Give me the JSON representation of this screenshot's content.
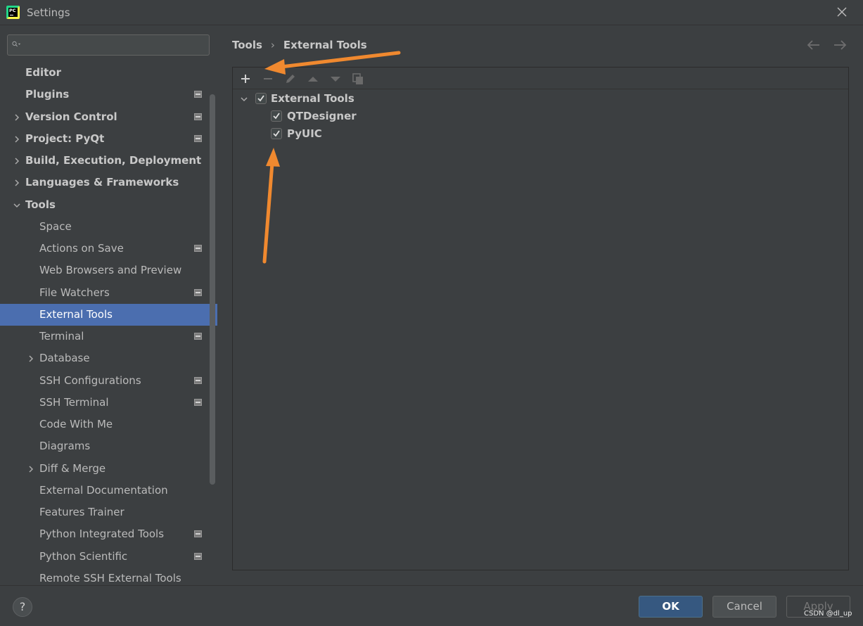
{
  "window": {
    "title": "Settings",
    "close_icon": "close-icon",
    "app_icon_text": "PC"
  },
  "search": {
    "value": "",
    "placeholder": ""
  },
  "sidebar": {
    "items": [
      {
        "label": "Editor",
        "level": 0,
        "expandable": false,
        "expanded": false,
        "config_icon": false,
        "selected": false
      },
      {
        "label": "Plugins",
        "level": 0,
        "expandable": false,
        "expanded": false,
        "config_icon": true,
        "selected": false
      },
      {
        "label": "Version Control",
        "level": 0,
        "expandable": true,
        "expanded": false,
        "config_icon": true,
        "selected": false
      },
      {
        "label": "Project: PyQt",
        "level": 0,
        "expandable": true,
        "expanded": false,
        "config_icon": true,
        "selected": false
      },
      {
        "label": "Build, Execution, Deployment",
        "level": 0,
        "expandable": true,
        "expanded": false,
        "config_icon": false,
        "selected": false
      },
      {
        "label": "Languages & Frameworks",
        "level": 0,
        "expandable": true,
        "expanded": false,
        "config_icon": false,
        "selected": false
      },
      {
        "label": "Tools",
        "level": 0,
        "expandable": true,
        "expanded": true,
        "config_icon": false,
        "selected": false
      },
      {
        "label": "Space",
        "level": 1,
        "expandable": false,
        "expanded": false,
        "config_icon": false,
        "selected": false
      },
      {
        "label": "Actions on Save",
        "level": 1,
        "expandable": false,
        "expanded": false,
        "config_icon": true,
        "selected": false
      },
      {
        "label": "Web Browsers and Preview",
        "level": 1,
        "expandable": false,
        "expanded": false,
        "config_icon": false,
        "selected": false
      },
      {
        "label": "File Watchers",
        "level": 1,
        "expandable": false,
        "expanded": false,
        "config_icon": true,
        "selected": false
      },
      {
        "label": "External Tools",
        "level": 1,
        "expandable": false,
        "expanded": false,
        "config_icon": false,
        "selected": true
      },
      {
        "label": "Terminal",
        "level": 1,
        "expandable": false,
        "expanded": false,
        "config_icon": true,
        "selected": false
      },
      {
        "label": "Database",
        "level": 1,
        "expandable": true,
        "expanded": false,
        "config_icon": false,
        "selected": false
      },
      {
        "label": "SSH Configurations",
        "level": 1,
        "expandable": false,
        "expanded": false,
        "config_icon": true,
        "selected": false
      },
      {
        "label": "SSH Terminal",
        "level": 1,
        "expandable": false,
        "expanded": false,
        "config_icon": true,
        "selected": false
      },
      {
        "label": "Code With Me",
        "level": 1,
        "expandable": false,
        "expanded": false,
        "config_icon": false,
        "selected": false
      },
      {
        "label": "Diagrams",
        "level": 1,
        "expandable": false,
        "expanded": false,
        "config_icon": false,
        "selected": false
      },
      {
        "label": "Diff & Merge",
        "level": 1,
        "expandable": true,
        "expanded": false,
        "config_icon": false,
        "selected": false
      },
      {
        "label": "External Documentation",
        "level": 1,
        "expandable": false,
        "expanded": false,
        "config_icon": false,
        "selected": false
      },
      {
        "label": "Features Trainer",
        "level": 1,
        "expandable": false,
        "expanded": false,
        "config_icon": false,
        "selected": false
      },
      {
        "label": "Python Integrated Tools",
        "level": 1,
        "expandable": false,
        "expanded": false,
        "config_icon": true,
        "selected": false
      },
      {
        "label": "Python Scientific",
        "level": 1,
        "expandable": false,
        "expanded": false,
        "config_icon": true,
        "selected": false
      },
      {
        "label": "Remote SSH External Tools",
        "level": 1,
        "expandable": false,
        "expanded": false,
        "config_icon": false,
        "selected": false
      }
    ]
  },
  "breadcrumb": {
    "parent": "Tools",
    "separator": "›",
    "current": "External Tools"
  },
  "toolbar": {
    "buttons": [
      "add-icon",
      "remove-icon",
      "edit-icon",
      "move-up-icon",
      "move-down-icon",
      "copy-icon"
    ]
  },
  "tools_tree": {
    "group": {
      "label": "External Tools",
      "checked": true,
      "expanded": true
    },
    "children": [
      {
        "label": "QTDesigner",
        "checked": true
      },
      {
        "label": "PyUIC",
        "checked": true
      }
    ]
  },
  "footer": {
    "help_label": "?",
    "ok_label": "OK",
    "cancel_label": "Cancel",
    "apply_label": "Apply"
  },
  "watermark": "CSDN @dl_up",
  "colors": {
    "background": "#3c3f41",
    "selection": "#4b6eaf",
    "ok_button": "#365880",
    "annotation_arrow": "#f0892f"
  }
}
